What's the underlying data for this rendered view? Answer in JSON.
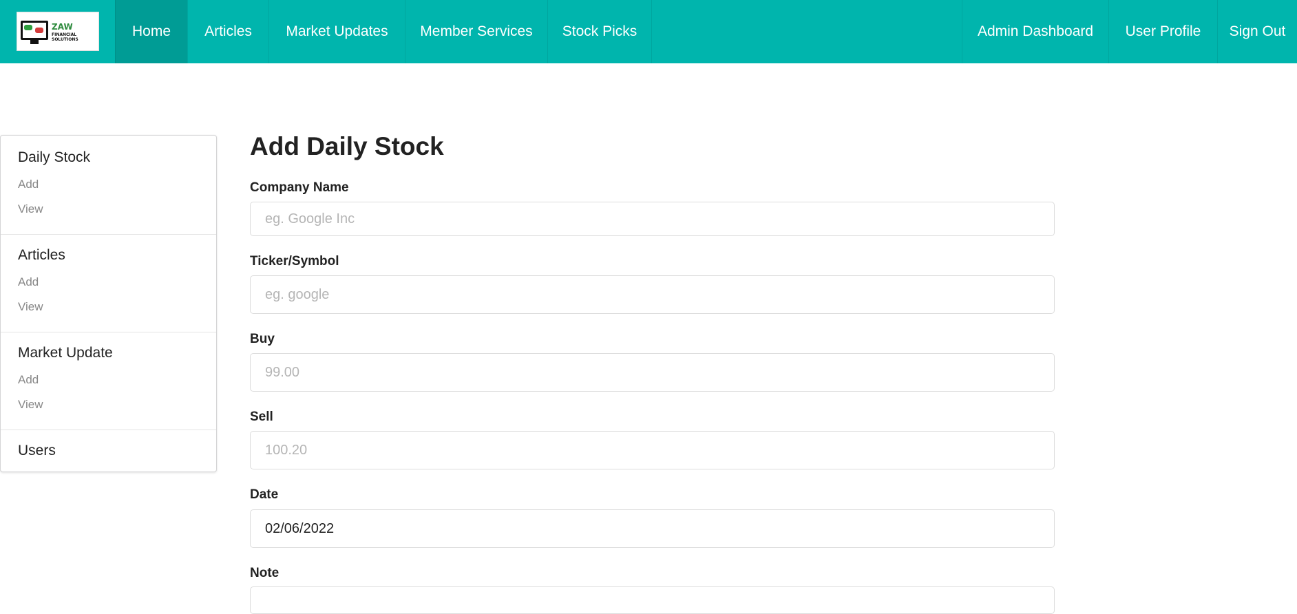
{
  "logo": {
    "line1": "ZAW",
    "line2": "FINANCIAL SOLUTIONS"
  },
  "nav": {
    "left": [
      "Home",
      "Articles",
      "Market Updates",
      "Member Services",
      "Stock Picks"
    ],
    "right": [
      "Admin Dashboard",
      "User Profile",
      "Sign Out"
    ],
    "active": "Home"
  },
  "sidebar": {
    "sections": [
      {
        "title": "Daily Stock",
        "items": [
          "Add",
          "View"
        ]
      },
      {
        "title": "Articles",
        "items": [
          "Add",
          "View"
        ]
      },
      {
        "title": "Market Update",
        "items": [
          "Add",
          "View"
        ]
      },
      {
        "title": "Users",
        "items": []
      }
    ]
  },
  "form": {
    "title": "Add Daily Stock",
    "fields": [
      {
        "label": "Company Name",
        "placeholder": "eg. Google Inc",
        "value": ""
      },
      {
        "label": "Ticker/Symbol",
        "placeholder": "eg. google",
        "value": ""
      },
      {
        "label": "Buy",
        "placeholder": "99.00",
        "value": ""
      },
      {
        "label": "Sell",
        "placeholder": "100.20",
        "value": ""
      },
      {
        "label": "Date",
        "placeholder": "",
        "value": "02/06/2022"
      },
      {
        "label": "Note",
        "placeholder": "",
        "value": ""
      }
    ]
  },
  "colors": {
    "nav_bg": "#00b5ad",
    "nav_active": "#009c95"
  }
}
